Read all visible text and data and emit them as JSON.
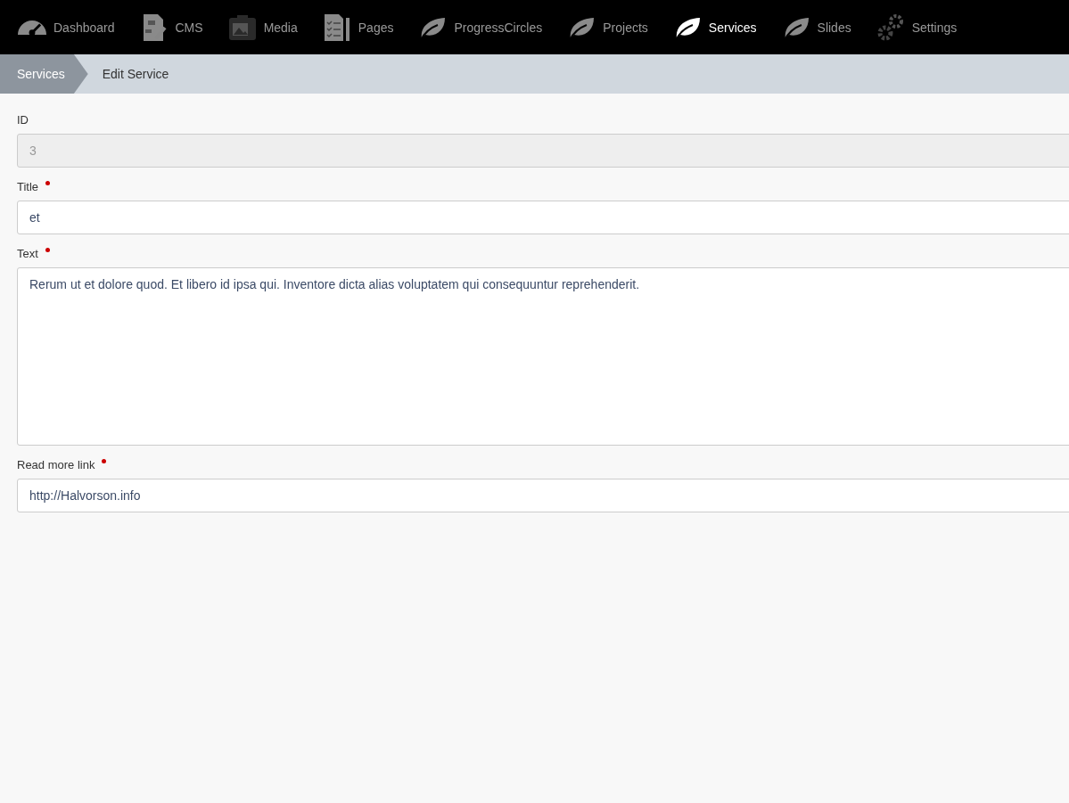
{
  "nav": [
    {
      "label": "Dashboard",
      "kind": "gauge",
      "selected": false
    },
    {
      "label": "CMS",
      "kind": "diagram",
      "selected": false
    },
    {
      "label": "Media",
      "kind": "camera",
      "selected": false
    },
    {
      "label": "Pages",
      "kind": "checklist",
      "selected": false
    },
    {
      "label": "ProgressCircles",
      "kind": "leaf",
      "selected": false
    },
    {
      "label": "Projects",
      "kind": "leaf",
      "selected": false
    },
    {
      "label": "Services",
      "kind": "leaf",
      "selected": true
    },
    {
      "label": "Slides",
      "kind": "leaf",
      "selected": false
    },
    {
      "label": "Settings",
      "kind": "gears",
      "selected": false
    }
  ],
  "breadcrumb": [
    "Services",
    "Edit Service"
  ],
  "fields": [
    {
      "label": "ID",
      "kind": "input",
      "value": "3",
      "required": false,
      "disabled": true
    },
    {
      "label": "Title",
      "kind": "input",
      "value": "et",
      "required": true,
      "disabled": false
    },
    {
      "label": "Text",
      "kind": "textarea",
      "value": "Rerum ut et dolore quod. Et libero id ipsa qui. Inventore dicta alias voluptatem qui consequuntur reprehenderit.",
      "required": true,
      "disabled": false
    },
    {
      "label": "Read more link",
      "kind": "input",
      "value": "http://Halvorson.info",
      "required": true,
      "disabled": false
    }
  ]
}
